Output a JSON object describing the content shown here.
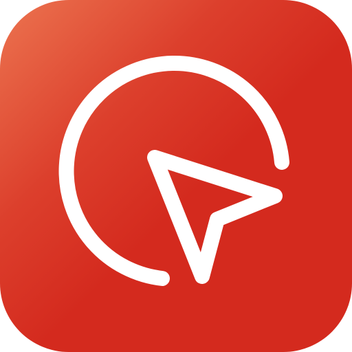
{
  "app_icon": {
    "icon_name": "cursor-click-icon",
    "colors": {
      "background_primary": "#d42a1e",
      "background_highlight": "#ec7450",
      "glyph": "#ffffff"
    }
  }
}
